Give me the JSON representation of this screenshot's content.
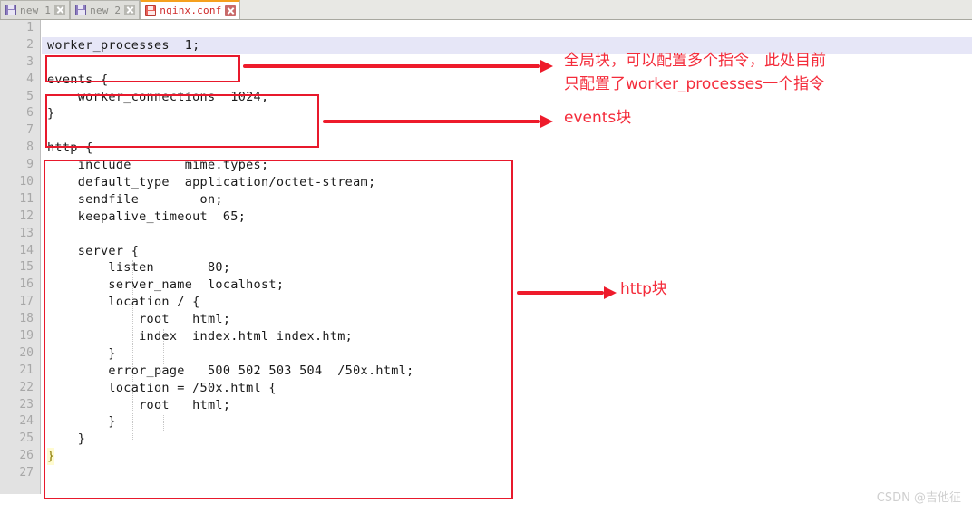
{
  "tabs": [
    {
      "label": "new 1",
      "active": false,
      "icon": "floppy-disk-icon",
      "close_icon": "close-icon"
    },
    {
      "label": "new 2",
      "active": false,
      "icon": "floppy-disk-icon",
      "close_icon": "close-icon"
    },
    {
      "label": "nginx.conf",
      "active": true,
      "icon": "floppy-disk-icon",
      "close_icon": "close-icon"
    }
  ],
  "editor": {
    "line_numbers": [
      "1",
      "2",
      "3",
      "4",
      "5",
      "6",
      "7",
      "8",
      "9",
      "10",
      "11",
      "12",
      "13",
      "14",
      "15",
      "16",
      "17",
      "18",
      "19",
      "20",
      "21",
      "22",
      "23",
      "24",
      "25",
      "26",
      "27"
    ],
    "current_line": 2,
    "lines": [
      "",
      "worker_processes  1;",
      "",
      "events {",
      "    worker_connections  1024;",
      "}",
      "",
      "http {",
      "    include       mime.types;",
      "    default_type  application/octet-stream;",
      "    sendfile        on;",
      "    keepalive_timeout  65;",
      "",
      "    server {",
      "        listen       80;",
      "        server_name  localhost;",
      "        location / {",
      "            root   html;",
      "            index  index.html index.htm;",
      "        }",
      "        error_page   500 502 503 504  /50x.html;",
      "        location = /50x.html {",
      "            root   html;",
      "        }",
      "    }",
      "}",
      ""
    ]
  },
  "annotations": {
    "global_block": "全局块，可以配置多个指令，此处目前\n只配置了worker_processes一个指令",
    "events_block": "events块",
    "http_block": "http块"
  },
  "colors": {
    "annotation_red": "#f42c3b",
    "box_red": "#e8192c",
    "active_tab_accent": "#f5a01e",
    "current_line_highlight": "#e6e6f7",
    "gutter_bg": "#e2e2e2"
  },
  "watermark": "CSDN @吉他征"
}
